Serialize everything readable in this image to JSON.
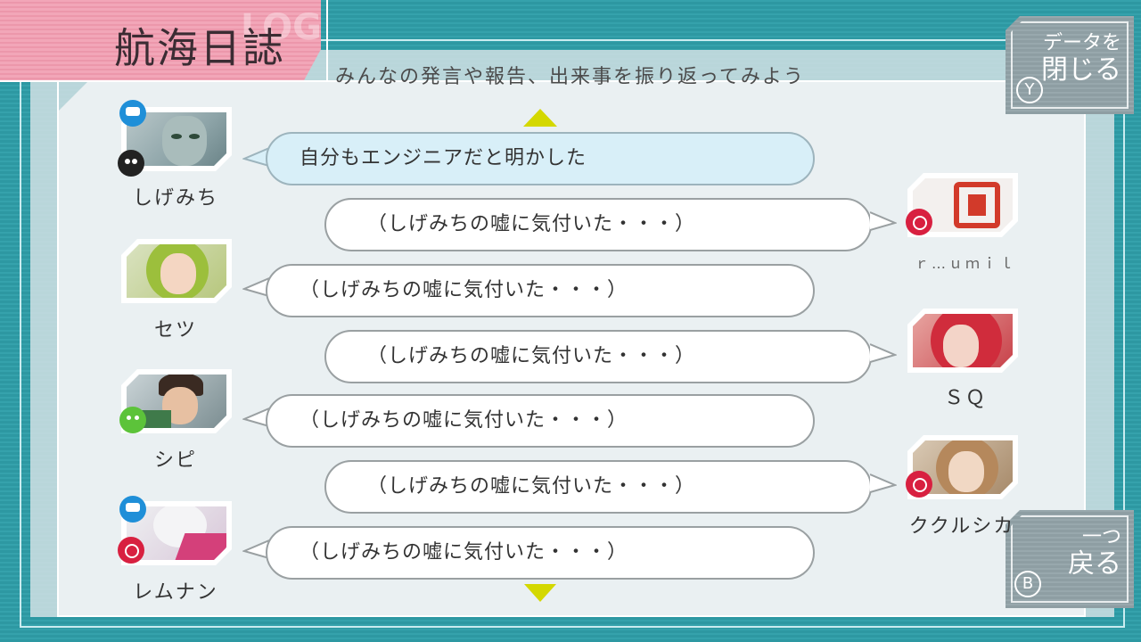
{
  "header": {
    "title": "航海日誌",
    "ghost": "LOG",
    "subtitle": "みんなの発言や報告、出来事を振り返ってみよう"
  },
  "buttons": {
    "close": {
      "line1": "データを",
      "line2": "閉じる",
      "key": "Y"
    },
    "back": {
      "line1": "一つ",
      "line2": "戻る",
      "key": "B"
    }
  },
  "entries": [
    {
      "speaker": "しげみち",
      "side": "left",
      "text": "自分もエンジニアだと明かした",
      "highlight": true,
      "roles": [
        "engineer-icon",
        "bomb-icon"
      ]
    },
    {
      "speaker": "ｒ…ｕｍｉｌ",
      "side": "right",
      "text": "（しげみちの嘘に気付いた・・・）",
      "highlight": false,
      "roles": [
        "bug-icon"
      ]
    },
    {
      "speaker": "セツ",
      "side": "left",
      "text": "（しげみちの嘘に気付いた・・・）",
      "highlight": false,
      "roles": []
    },
    {
      "speaker": "ＳＱ",
      "side": "right",
      "text": "（しげみちの嘘に気付いた・・・）",
      "highlight": false,
      "roles": []
    },
    {
      "speaker": "シピ",
      "side": "left",
      "text": "（しげみちの嘘に気付いた・・・）",
      "highlight": false,
      "roles": [
        "alien-icon"
      ]
    },
    {
      "speaker": "ククルシカ",
      "side": "right",
      "text": "（しげみちの嘘に気付いた・・・）",
      "highlight": false,
      "roles": [
        "bug-icon"
      ]
    },
    {
      "speaker": "レムナン",
      "side": "left",
      "text": "（しげみちの嘘に気付いた・・・）",
      "highlight": false,
      "roles": [
        "engineer-icon",
        "bug-icon"
      ]
    }
  ],
  "colors": {
    "engineer": "#1f8fd8",
    "bug": "#d82040",
    "alien": "#5cc33a",
    "arrow": "#d4d800",
    "title_bg": "#f2a6b8"
  }
}
